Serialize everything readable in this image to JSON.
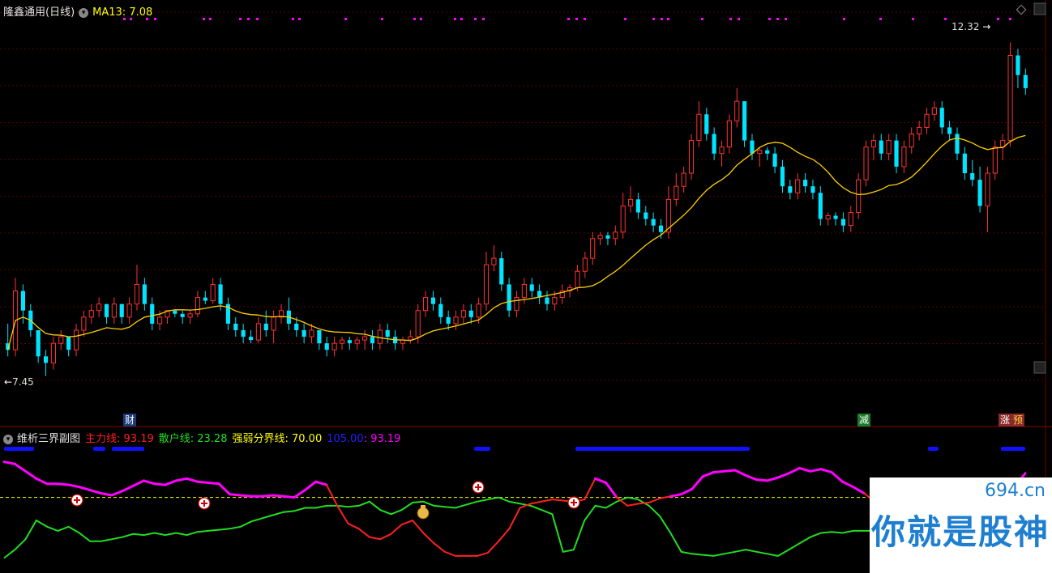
{
  "main_header": {
    "symbol": "隆鑫通用(日线)",
    "ma_label": "MA13: 7.08"
  },
  "sub_header": {
    "title": "维析三界副图",
    "s1": "主力线: 93.19",
    "s2": "散户线: 23.28",
    "s3": "强弱分界线: 70.00",
    "s4": "105.00",
    "s5": ": 93.19"
  },
  "labels": {
    "high": "12.32",
    "low": "7.45"
  },
  "markers": {
    "cai": "财",
    "jian": "减",
    "zhang": "涨",
    "yu": "预"
  },
  "watermark": {
    "top": "694.cn",
    "main": "你就是股神"
  },
  "colors": {
    "up": "#ff3232",
    "down": "#00e5ff",
    "ma": "#ffd000",
    "main_line": "#ff2020",
    "main_strong": "#ff00ff",
    "retail_line": "#22dd22",
    "threshold": "#ffff00",
    "top_bar": "#1010ff"
  },
  "chart_data": [
    {
      "type": "candlestick",
      "series_name": "隆鑫通用(日线)",
      "ylim": [
        6.8,
        12.8
      ],
      "candles": [
        [
          7.8,
          8.1,
          7.6,
          7.7
        ],
        [
          7.7,
          8.8,
          7.6,
          8.6
        ],
        [
          8.6,
          8.7,
          8.1,
          8.3
        ],
        [
          8.3,
          8.4,
          7.9,
          8.0
        ],
        [
          8.0,
          8.0,
          7.5,
          7.6
        ],
        [
          7.6,
          7.7,
          7.3,
          7.5
        ],
        [
          7.5,
          7.9,
          7.4,
          7.8
        ],
        [
          7.8,
          8.0,
          7.7,
          7.9
        ],
        [
          7.9,
          7.9,
          7.6,
          7.7
        ],
        [
          7.7,
          8.1,
          7.6,
          8.0
        ],
        [
          8.0,
          8.3,
          7.9,
          8.2
        ],
        [
          8.2,
          8.4,
          8.1,
          8.3
        ],
        [
          8.3,
          8.5,
          8.2,
          8.4
        ],
        [
          8.4,
          8.4,
          8.1,
          8.2
        ],
        [
          8.2,
          8.5,
          8.1,
          8.4
        ],
        [
          8.4,
          8.4,
          8.1,
          8.2
        ],
        [
          8.2,
          8.5,
          8.1,
          8.4
        ],
        [
          8.4,
          9.0,
          8.3,
          8.7
        ],
        [
          8.7,
          8.8,
          8.3,
          8.4
        ],
        [
          8.4,
          8.5,
          8.0,
          8.1
        ],
        [
          8.1,
          8.3,
          8.0,
          8.2
        ],
        [
          8.2,
          8.3,
          8.1,
          8.3
        ],
        [
          8.3,
          8.3,
          8.2,
          8.25
        ],
        [
          8.25,
          8.3,
          8.1,
          8.2
        ],
        [
          8.2,
          8.3,
          8.1,
          8.25
        ],
        [
          8.25,
          8.6,
          8.2,
          8.5
        ],
        [
          8.5,
          8.6,
          8.4,
          8.45
        ],
        [
          8.45,
          8.8,
          8.4,
          8.7
        ],
        [
          8.7,
          8.8,
          8.3,
          8.4
        ],
        [
          8.4,
          8.5,
          8.0,
          8.1
        ],
        [
          8.1,
          8.2,
          7.9,
          8.0
        ],
        [
          8.0,
          8.1,
          7.8,
          7.9
        ],
        [
          7.9,
          8.0,
          7.8,
          7.85
        ],
        [
          7.85,
          8.2,
          7.8,
          8.1
        ],
        [
          8.1,
          8.3,
          7.9,
          8.0
        ],
        [
          8.0,
          8.3,
          7.8,
          8.2
        ],
        [
          8.2,
          8.4,
          8.1,
          8.3
        ],
        [
          8.3,
          8.5,
          8.0,
          8.1
        ],
        [
          8.1,
          8.2,
          7.9,
          8.0
        ],
        [
          8.0,
          8.1,
          7.8,
          7.9
        ],
        [
          7.9,
          8.1,
          7.8,
          8.0
        ],
        [
          8.0,
          8.0,
          7.7,
          7.8
        ],
        [
          7.8,
          7.9,
          7.6,
          7.7
        ],
        [
          7.7,
          7.9,
          7.6,
          7.8
        ],
        [
          7.8,
          7.9,
          7.7,
          7.85
        ],
        [
          7.85,
          7.9,
          7.7,
          7.8
        ],
        [
          7.8,
          7.9,
          7.7,
          7.85
        ],
        [
          7.85,
          8.0,
          7.7,
          7.9
        ],
        [
          7.9,
          8.0,
          7.7,
          7.8
        ],
        [
          7.8,
          8.1,
          7.7,
          8.0
        ],
        [
          8.0,
          8.1,
          7.8,
          7.9
        ],
        [
          7.9,
          8.0,
          7.7,
          7.8
        ],
        [
          7.8,
          7.9,
          7.7,
          7.85
        ],
        [
          7.85,
          8.0,
          7.8,
          7.9
        ],
        [
          7.9,
          8.4,
          7.8,
          8.3
        ],
        [
          8.3,
          8.6,
          8.2,
          8.5
        ],
        [
          8.5,
          8.6,
          8.3,
          8.4
        ],
        [
          8.4,
          8.5,
          8.1,
          8.2
        ],
        [
          8.2,
          8.3,
          8.0,
          8.1
        ],
        [
          8.1,
          8.3,
          8.0,
          8.2
        ],
        [
          8.2,
          8.4,
          8.1,
          8.3
        ],
        [
          8.3,
          8.4,
          8.1,
          8.2
        ],
        [
          8.2,
          8.5,
          8.1,
          8.4
        ],
        [
          8.4,
          9.2,
          8.3,
          9.0
        ],
        [
          9.0,
          9.3,
          8.9,
          9.1
        ],
        [
          9.1,
          9.2,
          8.6,
          8.7
        ],
        [
          8.7,
          8.8,
          8.2,
          8.3
        ],
        [
          8.3,
          8.6,
          8.2,
          8.5
        ],
        [
          8.5,
          8.8,
          8.4,
          8.7
        ],
        [
          8.7,
          8.8,
          8.5,
          8.6
        ],
        [
          8.6,
          8.7,
          8.4,
          8.5
        ],
        [
          8.5,
          8.6,
          8.3,
          8.4
        ],
        [
          8.4,
          8.6,
          8.3,
          8.5
        ],
        [
          8.5,
          8.7,
          8.4,
          8.6
        ],
        [
          8.6,
          8.7,
          8.5,
          8.65
        ],
        [
          8.65,
          9.0,
          8.6,
          8.9
        ],
        [
          8.9,
          9.2,
          8.8,
          9.1
        ],
        [
          9.1,
          9.5,
          9.0,
          9.4
        ],
        [
          9.4,
          9.5,
          9.3,
          9.45
        ],
        [
          9.45,
          9.5,
          9.3,
          9.4
        ],
        [
          9.4,
          9.6,
          9.3,
          9.5
        ],
        [
          9.5,
          10.1,
          9.4,
          9.9
        ],
        [
          9.9,
          10.2,
          9.8,
          10.0
        ],
        [
          10.0,
          10.1,
          9.7,
          9.8
        ],
        [
          9.8,
          9.9,
          9.6,
          9.7
        ],
        [
          9.7,
          9.8,
          9.5,
          9.6
        ],
        [
          9.6,
          9.7,
          9.4,
          9.5
        ],
        [
          9.5,
          10.2,
          9.4,
          10.0
        ],
        [
          10.0,
          10.4,
          9.9,
          10.2
        ],
        [
          10.2,
          10.5,
          10.1,
          10.4
        ],
        [
          10.4,
          11.0,
          10.3,
          10.9
        ],
        [
          10.9,
          11.5,
          10.8,
          11.3
        ],
        [
          11.3,
          11.4,
          10.9,
          11.0
        ],
        [
          11.0,
          11.1,
          10.6,
          10.7
        ],
        [
          10.7,
          10.9,
          10.5,
          10.8
        ],
        [
          10.8,
          11.3,
          10.7,
          11.2
        ],
        [
          11.2,
          11.7,
          11.1,
          11.5
        ],
        [
          11.5,
          11.5,
          10.8,
          10.9
        ],
        [
          10.9,
          11.0,
          10.6,
          10.7
        ],
        [
          10.7,
          10.8,
          10.5,
          10.75
        ],
        [
          10.75,
          10.8,
          10.6,
          10.7
        ],
        [
          10.7,
          10.8,
          10.4,
          10.5
        ],
        [
          10.5,
          10.6,
          10.1,
          10.2
        ],
        [
          10.2,
          10.3,
          10.0,
          10.1
        ],
        [
          10.1,
          10.4,
          10.0,
          10.3
        ],
        [
          10.3,
          10.4,
          10.1,
          10.2
        ],
        [
          10.2,
          10.3,
          10.0,
          10.1
        ],
        [
          10.1,
          10.2,
          9.6,
          9.7
        ],
        [
          9.7,
          9.8,
          9.6,
          9.75
        ],
        [
          9.75,
          9.8,
          9.6,
          9.7
        ],
        [
          9.7,
          9.8,
          9.5,
          9.6
        ],
        [
          9.6,
          9.9,
          9.5,
          9.8
        ],
        [
          9.8,
          10.4,
          9.7,
          10.3
        ],
        [
          10.3,
          10.9,
          10.2,
          10.8
        ],
        [
          10.8,
          11.0,
          10.6,
          10.9
        ],
        [
          10.9,
          11.0,
          10.6,
          10.7
        ],
        [
          10.7,
          11.0,
          10.6,
          10.9
        ],
        [
          10.9,
          11.0,
          10.4,
          10.5
        ],
        [
          10.5,
          10.9,
          10.4,
          10.8
        ],
        [
          10.8,
          11.1,
          10.7,
          11.0
        ],
        [
          11.0,
          11.2,
          10.9,
          11.1
        ],
        [
          11.1,
          11.4,
          11.0,
          11.3
        ],
        [
          11.3,
          11.5,
          11.2,
          11.4
        ],
        [
          11.4,
          11.5,
          11.0,
          11.1
        ],
        [
          11.1,
          11.2,
          10.9,
          11.0
        ],
        [
          11.0,
          11.1,
          10.6,
          10.7
        ],
        [
          10.7,
          10.8,
          10.3,
          10.4
        ],
        [
          10.4,
          10.6,
          10.2,
          10.3
        ],
        [
          10.3,
          10.5,
          9.8,
          9.9
        ],
        [
          9.9,
          10.5,
          9.5,
          10.4
        ],
        [
          10.4,
          10.9,
          10.3,
          10.8
        ],
        [
          10.8,
          11.0,
          10.6,
          10.9
        ],
        [
          10.9,
          12.4,
          10.8,
          12.2
        ],
        [
          12.2,
          12.3,
          11.7,
          11.9
        ],
        [
          11.9,
          12.0,
          11.6,
          11.7
        ]
      ]
    },
    {
      "type": "line",
      "series_name": "维析三界副图",
      "ylim": [
        0,
        120
      ],
      "threshold": 70.0,
      "top_value": 105.0,
      "series": [
        {
          "name": "主力线",
          "values": [
            104,
            102,
            95,
            88,
            83,
            83,
            82,
            80,
            77,
            74,
            72,
            76,
            81,
            86,
            83,
            82,
            86,
            88,
            85,
            84,
            83,
            73,
            72,
            71,
            71,
            72,
            71,
            70,
            77,
            85,
            82,
            62,
            45,
            40,
            32,
            30,
            35,
            44,
            48,
            36,
            26,
            18,
            14,
            14,
            14,
            17,
            28,
            40,
            60,
            64,
            66,
            68,
            67,
            66,
            68,
            88,
            84,
            70,
            62,
            64,
            65,
            69,
            71,
            73,
            78,
            90,
            94,
            95,
            96,
            91,
            87,
            86,
            89,
            93,
            98,
            95,
            97,
            94,
            85,
            80,
            74,
            66,
            63,
            60,
            56,
            52,
            50,
            48,
            52,
            60,
            65,
            70,
            75,
            78,
            80,
            93
          ]
        },
        {
          "name": "散户线",
          "values": [
            12,
            20,
            30,
            48,
            42,
            38,
            42,
            36,
            28,
            28,
            30,
            32,
            35,
            34,
            36,
            34,
            36,
            34,
            37,
            38,
            39,
            40,
            42,
            47,
            50,
            53,
            56,
            57,
            60,
            60,
            62,
            62,
            61,
            62,
            66,
            58,
            54,
            58,
            65,
            66,
            62,
            61,
            60,
            63,
            66,
            68,
            70,
            66,
            64,
            62,
            58,
            54,
            18,
            20,
            48,
            62,
            60,
            66,
            70,
            68,
            62,
            52,
            36,
            18,
            16,
            15,
            14,
            16,
            18,
            20,
            18,
            16,
            14,
            20,
            26,
            32,
            36,
            37,
            36,
            38,
            38,
            38,
            40,
            42,
            42,
            44,
            45,
            44,
            46,
            48,
            48,
            50,
            48,
            45,
            44,
            23
          ]
        }
      ]
    }
  ]
}
